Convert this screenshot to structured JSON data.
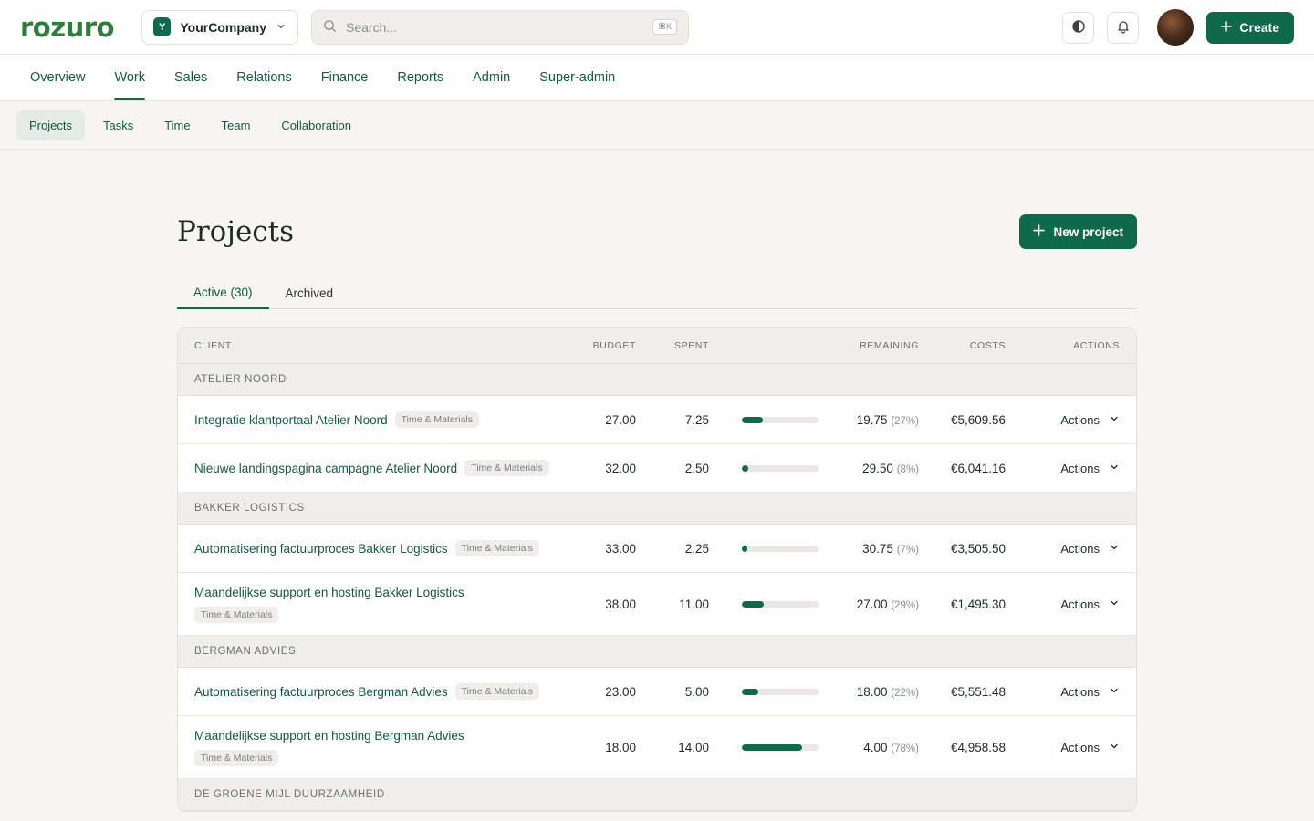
{
  "brand": {
    "logo": "rozuro"
  },
  "company": {
    "initial": "Y",
    "name": "YourCompany"
  },
  "search": {
    "placeholder": "Search...",
    "shortcut": "⌘K"
  },
  "header": {
    "create_label": "Create"
  },
  "main_nav": [
    {
      "label": "Overview"
    },
    {
      "label": "Work",
      "active": true
    },
    {
      "label": "Sales"
    },
    {
      "label": "Relations"
    },
    {
      "label": "Finance"
    },
    {
      "label": "Reports"
    },
    {
      "label": "Admin"
    },
    {
      "label": "Super-admin"
    }
  ],
  "sub_nav": [
    {
      "label": "Projects",
      "active": true
    },
    {
      "label": "Tasks"
    },
    {
      "label": "Time"
    },
    {
      "label": "Team"
    },
    {
      "label": "Collaboration"
    }
  ],
  "page": {
    "title": "Projects",
    "new_button": "New project"
  },
  "tabs": [
    {
      "label": "Active (30)",
      "active": true
    },
    {
      "label": "Archived"
    }
  ],
  "table": {
    "columns": {
      "client": "CLIENT",
      "budget": "BUDGET",
      "spent": "SPENT",
      "remaining": "REMAINING",
      "costs": "COSTS",
      "actions": "ACTIONS"
    },
    "action_label": "Actions",
    "groups": [
      {
        "name": "ATELIER NOORD",
        "projects": [
          {
            "name": "Integratie klantportaal Atelier Noord",
            "type": "Time & Materials",
            "budget": "27.00",
            "spent": "7.25",
            "progress": 0.27,
            "remaining": "19.75",
            "remaining_pct": "(27%)",
            "costs": "€5,609.56",
            "wrap": false
          },
          {
            "name": "Nieuwe landingspagina campagne Atelier Noord",
            "type": "Time & Materials",
            "budget": "32.00",
            "spent": "2.50",
            "progress": 0.08,
            "remaining": "29.50",
            "remaining_pct": "(8%)",
            "costs": "€6,041.16",
            "wrap": false
          }
        ]
      },
      {
        "name": "BAKKER LOGISTICS",
        "projects": [
          {
            "name": "Automatisering factuurproces Bakker Logistics",
            "type": "Time & Materials",
            "budget": "33.00",
            "spent": "2.25",
            "progress": 0.07,
            "remaining": "30.75",
            "remaining_pct": "(7%)",
            "costs": "€3,505.50",
            "wrap": false
          },
          {
            "name": "Maandelijkse support en hosting Bakker Logistics",
            "type": "Time & Materials",
            "budget": "38.00",
            "spent": "11.00",
            "progress": 0.29,
            "remaining": "27.00",
            "remaining_pct": "(29%)",
            "costs": "€1,495.30",
            "wrap": true
          }
        ]
      },
      {
        "name": "BERGMAN ADVIES",
        "projects": [
          {
            "name": "Automatisering factuurproces Bergman Advies",
            "type": "Time & Materials",
            "budget": "23.00",
            "spent": "5.00",
            "progress": 0.22,
            "remaining": "18.00",
            "remaining_pct": "(22%)",
            "costs": "€5,551.48",
            "wrap": false
          },
          {
            "name": "Maandelijkse support en hosting Bergman Advies",
            "type": "Time & Materials",
            "budget": "18.00",
            "spent": "14.00",
            "progress": 0.78,
            "remaining": "4.00",
            "remaining_pct": "(78%)",
            "costs": "€4,958.58",
            "wrap": true
          }
        ]
      },
      {
        "name": "DE GROENE MIJL DUURZAAMHEID",
        "projects": []
      }
    ]
  },
  "icons": {
    "search": "search-icon",
    "chevron": "chevron-down-icon",
    "theme": "contrast-icon",
    "bell": "bell-icon",
    "plus": "plus-icon"
  },
  "colors": {
    "brand": "#2f7d3e",
    "accent": "#0f6a4c",
    "link": "#155a42"
  }
}
